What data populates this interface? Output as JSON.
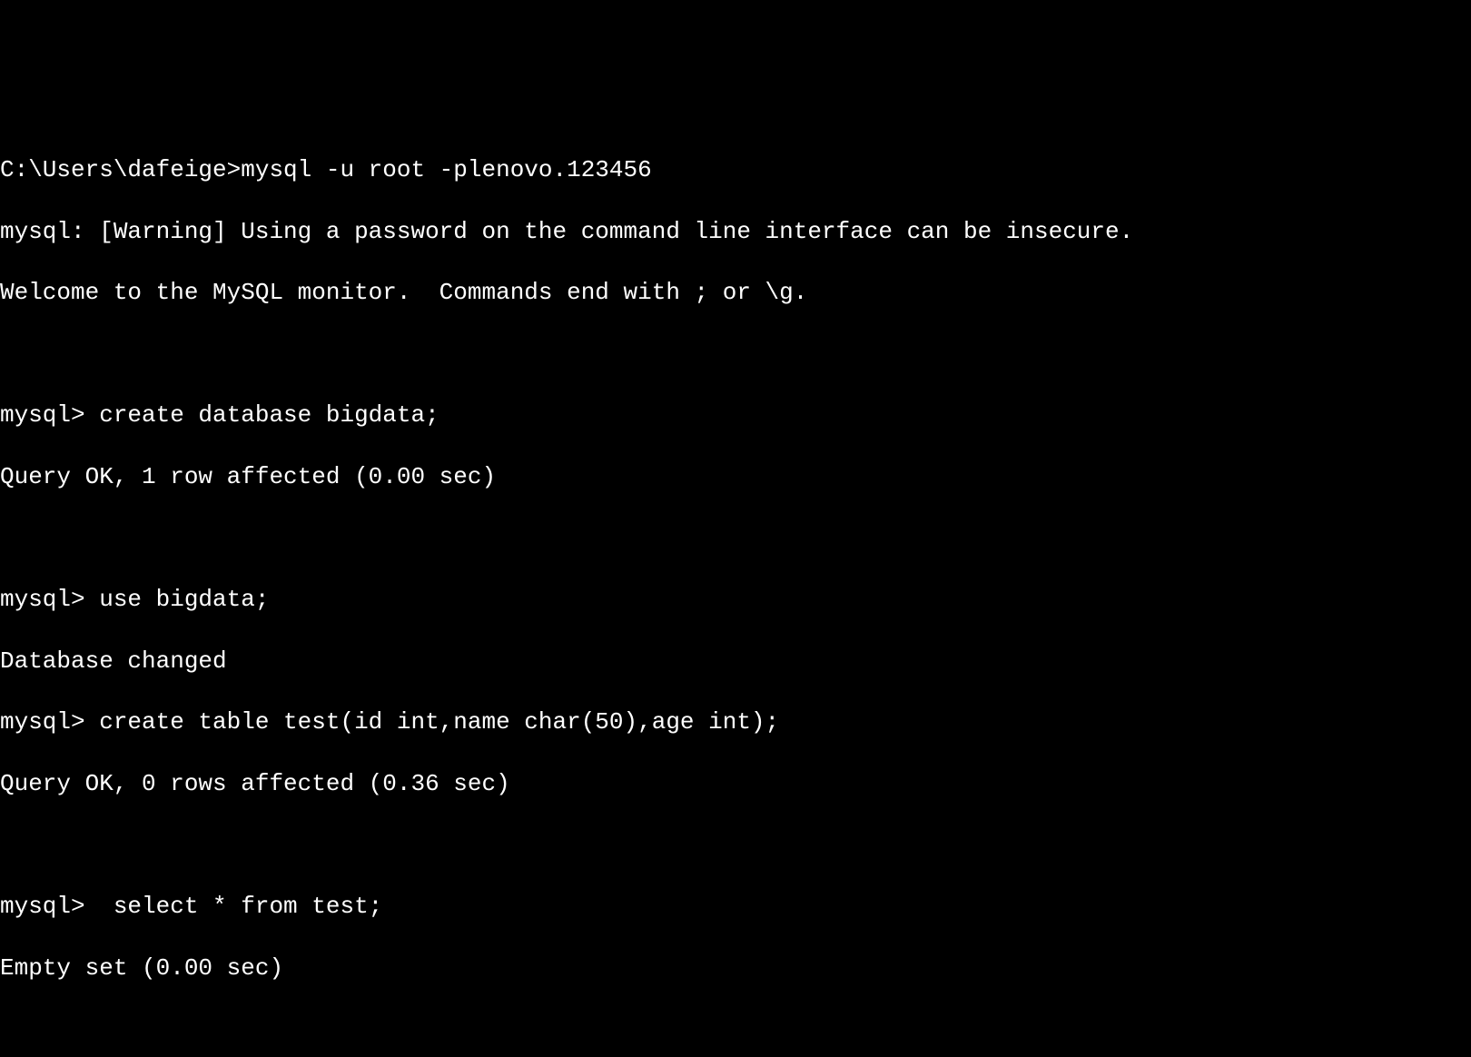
{
  "terminal": {
    "lines": [
      "C:\\Users\\dafeige>mysql -u root -plenovo.123456",
      "mysql: [Warning] Using a password on the command line interface can be insecure.",
      "Welcome to the MySQL monitor.  Commands end with ; or \\g.",
      "",
      "mysql> create database bigdata;",
      "Query OK, 1 row affected (0.00 sec)",
      "",
      "mysql> use bigdata;",
      "Database changed",
      "mysql> create table test(id int,name char(50),age int);",
      "Query OK, 0 rows affected (0.36 sec)",
      "",
      "mysql>  select * from test;",
      "Empty set (0.00 sec)"
    ]
  }
}
